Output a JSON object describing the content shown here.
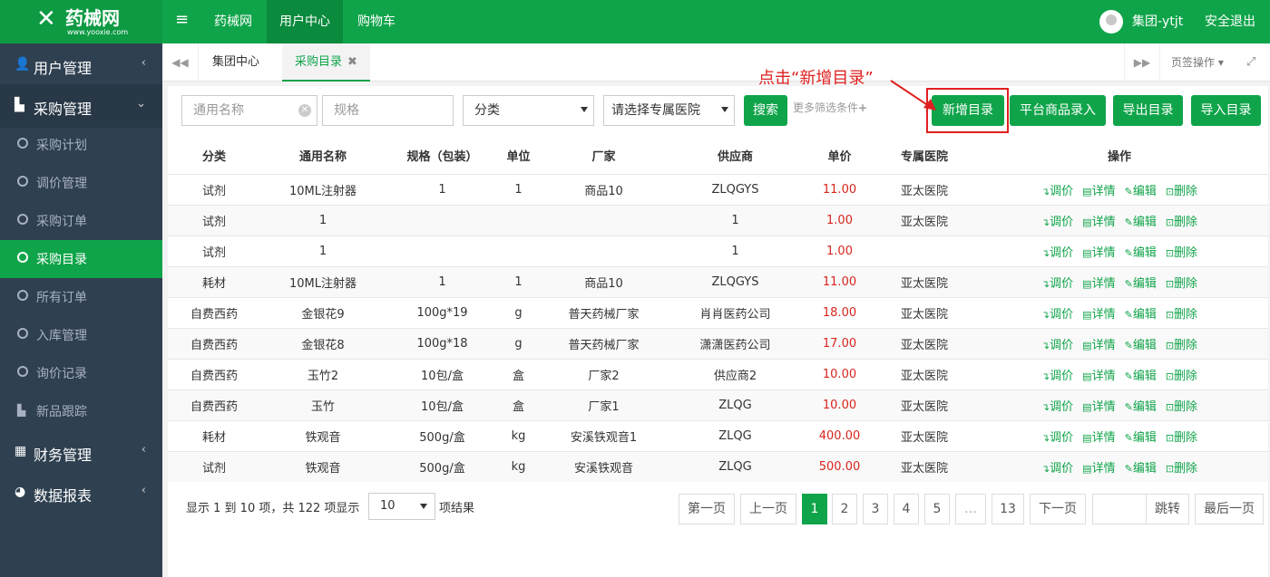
{
  "header": {
    "logo_text": "药械网",
    "logo_url": "www.yooxie.com",
    "nav": [
      "药械网",
      "用户中心",
      "购物车"
    ],
    "user_name": "集团-ytjt",
    "logout": "安全退出"
  },
  "sidebar": {
    "groups": [
      {
        "label": "用户管理",
        "icon": "user-icon"
      },
      {
        "label": "采购管理",
        "icon": "bag-icon"
      },
      {
        "label": "财务管理",
        "icon": "table-icon"
      },
      {
        "label": "数据报表",
        "icon": "pie-icon"
      }
    ],
    "subitems": [
      "采购计划",
      "调价管理",
      "采购订单",
      "采购目录",
      "所有订单",
      "入库管理",
      "询价记录",
      "新品跟踪"
    ]
  },
  "tabs": {
    "items": [
      "集团中心",
      "采购目录"
    ],
    "page_ops": "页签操作"
  },
  "filters": {
    "name_placeholder": "通用名称",
    "spec_placeholder": "规格",
    "category": "分类",
    "hospital": "请选择专属医院",
    "search": "搜索",
    "more": "更多筛选条件"
  },
  "actions": {
    "add": "新增目录",
    "platform": "平台商品录入",
    "export": "导出目录",
    "import": "导入目录"
  },
  "annotation": "点击“新增目录”",
  "table": {
    "headers": [
      "分类",
      "通用名称",
      "规格（包装）",
      "单位",
      "厂家",
      "供应商",
      "单价",
      "专属医院",
      "操作"
    ],
    "rows": [
      [
        "试剂",
        "10ML注射器",
        "1",
        "1",
        "商品10",
        "ZLQGYS",
        "11.00",
        "亚太医院"
      ],
      [
        "试剂",
        "1",
        "",
        "",
        "",
        "1",
        "1.00",
        "亚太医院"
      ],
      [
        "试剂",
        "1",
        "",
        "",
        "",
        "1",
        "1.00",
        ""
      ],
      [
        "耗材",
        "10ML注射器",
        "1",
        "1",
        "商品10",
        "ZLQGYS",
        "11.00",
        "亚太医院"
      ],
      [
        "自费西药",
        "金银花9",
        "100g*19",
        "g",
        "普天药械厂家",
        "肖肖医药公司",
        "18.00",
        "亚太医院"
      ],
      [
        "自费西药",
        "金银花8",
        "100g*18",
        "g",
        "普天药械厂家",
        "潇潇医药公司",
        "17.00",
        "亚太医院"
      ],
      [
        "自费西药",
        "玉竹2",
        "10包/盒",
        "盒",
        "厂家2",
        "供应商2",
        "10.00",
        "亚太医院"
      ],
      [
        "自费西药",
        "玉竹",
        "10包/盒",
        "盒",
        "厂家1",
        "ZLQG",
        "10.00",
        "亚太医院"
      ],
      [
        "耗材",
        "铁观音",
        "500g/盒",
        "kg",
        "安溪铁观音1",
        "ZLQG",
        "400.00",
        "亚太医院"
      ],
      [
        "试剂",
        "铁观音",
        "500g/盒",
        "kg",
        "安溪铁观音",
        "ZLQG",
        "500.00",
        "亚太医院"
      ]
    ],
    "ops": [
      "调价",
      "详情",
      "编辑",
      "删除"
    ]
  },
  "pagination": {
    "info": "显示 1 到 10 项，共 122 项显示",
    "page_size": "10",
    "suffix": "项结果",
    "first": "第一页",
    "prev": "上一页",
    "pages": [
      "1",
      "2",
      "3",
      "4",
      "5",
      "…",
      "13"
    ],
    "next": "下一页",
    "jump": "跳转",
    "last": "最后一页"
  },
  "colors": {
    "brand": "#10a44a",
    "sidebar": "#2f4050",
    "price": "#d9251d",
    "annotation": "#e02020"
  }
}
